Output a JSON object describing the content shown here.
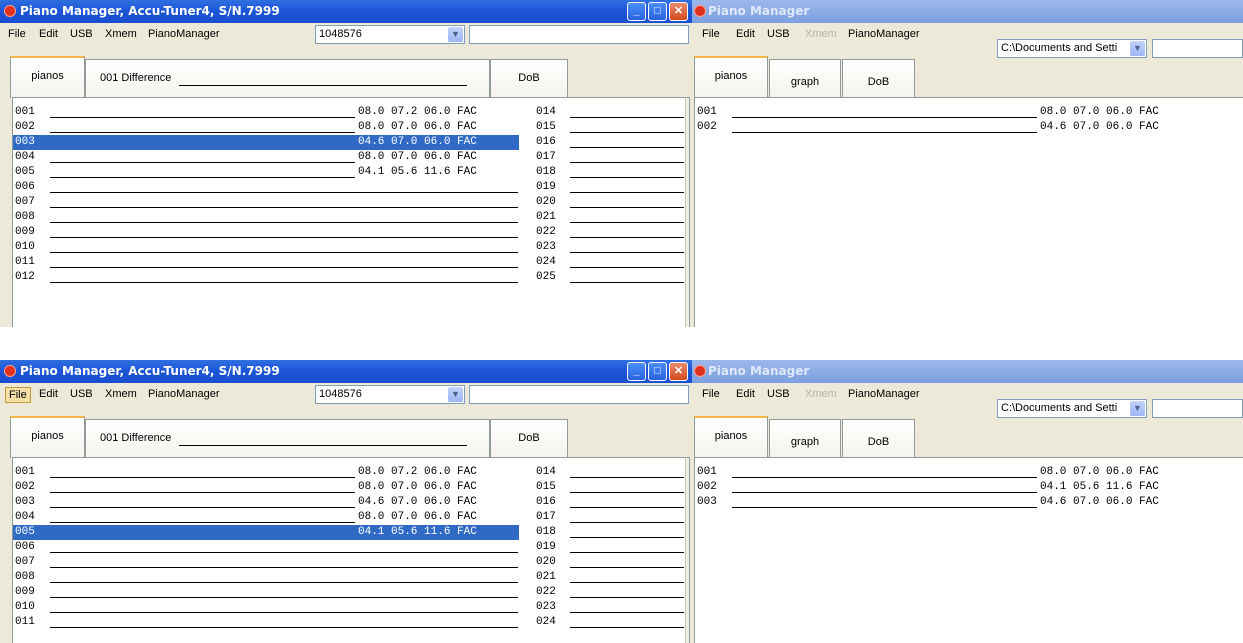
{
  "app": {
    "title_full": "Piano Manager, Accu-Tuner4, S/N.7999",
    "title_short": "Piano Manager",
    "window_buttons": {
      "minimize": "minimize-icon",
      "maximize": "maximize-icon",
      "close": "close-icon"
    }
  },
  "menu": {
    "file": "File",
    "edit": "Edit",
    "usb": "USB",
    "xmem": "Xmem",
    "piano_manager": "PianoManager"
  },
  "left_combo_value": "1048576",
  "right_combo_value": "C:\\Documents and Setti",
  "left_tabs": {
    "pianos": "pianos",
    "difference": "001 Difference",
    "dob": "DoB"
  },
  "right_tabs": {
    "pianos": "pianos",
    "graph": "graph",
    "dob": "DoB"
  },
  "colors": {
    "selection": "#316ac5",
    "titlebar": "#1c54d6",
    "tab_highlight": "#f7b64a"
  },
  "top_left_list": {
    "rows": [
      {
        "num": "001",
        "values": "08.0 07.2 06.0 FAC",
        "col2": "014"
      },
      {
        "num": "002",
        "values": "08.0 07.0 06.0 FAC",
        "col2": "015"
      },
      {
        "num": "003",
        "values": "04.6 07.0 06.0 FAC",
        "col2": "016",
        "selected": true
      },
      {
        "num": "004",
        "values": "08.0 07.0 06.0 FAC",
        "col2": "017"
      },
      {
        "num": "005",
        "values": "04.1 05.6 11.6 FAC",
        "col2": "018"
      },
      {
        "num": "006",
        "values": "",
        "col2": "019"
      },
      {
        "num": "007",
        "values": "",
        "col2": "020"
      },
      {
        "num": "008",
        "values": "",
        "col2": "021"
      },
      {
        "num": "009",
        "values": "",
        "col2": "022"
      },
      {
        "num": "010",
        "values": "",
        "col2": "023"
      },
      {
        "num": "011",
        "values": "",
        "col2": "024"
      },
      {
        "num": "012",
        "values": "",
        "col2": "025"
      }
    ]
  },
  "top_right_list": {
    "rows": [
      {
        "num": "001",
        "values": "08.0 07.0 06.0 FAC"
      },
      {
        "num": "002",
        "values": "04.6 07.0 06.0 FAC"
      }
    ]
  },
  "bottom_left_list": {
    "rows": [
      {
        "num": "001",
        "values": "08.0 07.2 06.0 FAC",
        "col2": "014"
      },
      {
        "num": "002",
        "values": "08.0 07.0 06.0 FAC",
        "col2": "015"
      },
      {
        "num": "003",
        "values": "04.6 07.0 06.0 FAC",
        "col2": "016"
      },
      {
        "num": "004",
        "values": "08.0 07.0 06.0 FAC",
        "col2": "017"
      },
      {
        "num": "005",
        "values": "04.1 05.6 11.6 FAC",
        "col2": "018",
        "selected": true
      },
      {
        "num": "006",
        "values": "",
        "col2": "019"
      },
      {
        "num": "007",
        "values": "",
        "col2": "020"
      },
      {
        "num": "008",
        "values": "",
        "col2": "021"
      },
      {
        "num": "009",
        "values": "",
        "col2": "022"
      },
      {
        "num": "010",
        "values": "",
        "col2": "023"
      },
      {
        "num": "011",
        "values": "",
        "col2": "024"
      }
    ]
  },
  "bottom_right_list": {
    "rows": [
      {
        "num": "001",
        "values": "08.0 07.0 06.0 FAC"
      },
      {
        "num": "002",
        "values": "04.1 05.6 11.6 FAC"
      },
      {
        "num": "003",
        "values": "04.6 07.0 06.0 FAC"
      }
    ]
  },
  "active_menu_bottom_left": "file"
}
